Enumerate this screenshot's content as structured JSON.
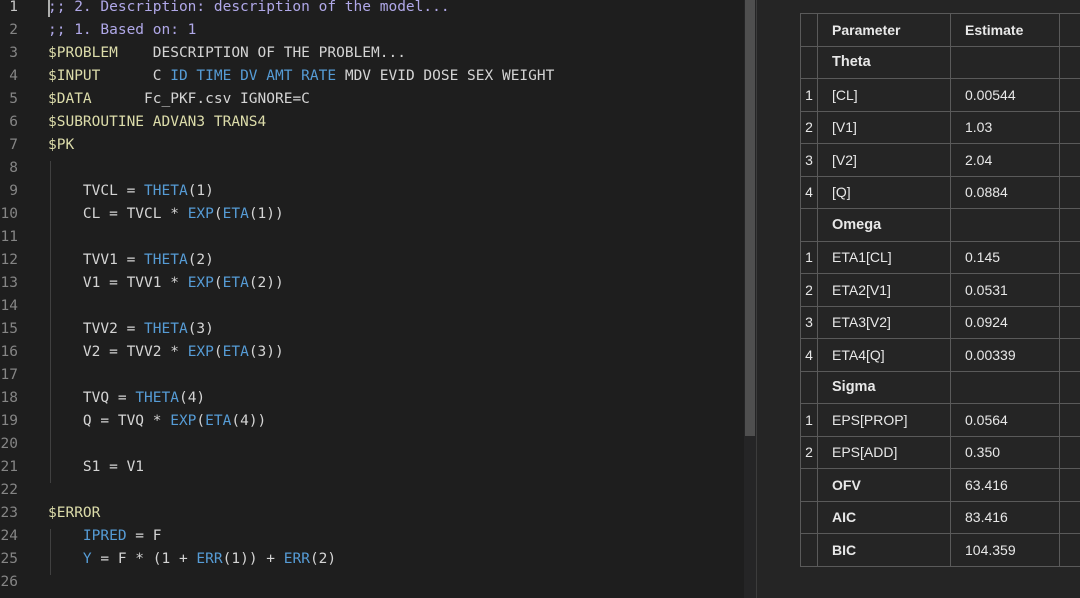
{
  "editor": {
    "lines": [
      {
        "n": "1",
        "tokens": [
          {
            "t": ";; 2. Description: description of the model...",
            "c": "cm2"
          }
        ]
      },
      {
        "n": "2",
        "tokens": [
          {
            "t": ";; 1. Based on: 1",
            "c": "cm2"
          }
        ]
      },
      {
        "n": "3",
        "tokens": [
          {
            "t": "$PROBLEM",
            "c": "kw"
          },
          {
            "t": "    DESCRIPTION OF THE PROBLEM...",
            "c": "pl"
          }
        ]
      },
      {
        "n": "4",
        "tokens": [
          {
            "t": "$INPUT",
            "c": "kw"
          },
          {
            "t": "      C ",
            "c": "pl"
          },
          {
            "t": "ID TIME DV AMT RATE",
            "c": "id"
          },
          {
            "t": " MDV EVID DOSE SEX WEIGHT",
            "c": "pl"
          }
        ]
      },
      {
        "n": "5",
        "tokens": [
          {
            "t": "$DATA",
            "c": "kw"
          },
          {
            "t": "      Fc_PKF.csv IGNORE=C",
            "c": "pl"
          }
        ]
      },
      {
        "n": "6",
        "tokens": [
          {
            "t": "$SUBROUTINE",
            "c": "kw"
          },
          {
            "t": " ADVAN3 TRANS4",
            "c": "kw"
          }
        ]
      },
      {
        "n": "7",
        "tokens": [
          {
            "t": "$PK",
            "c": "kw"
          }
        ]
      },
      {
        "n": "8",
        "tokens": []
      },
      {
        "n": "9",
        "tokens": [
          {
            "t": "    TVCL = ",
            "c": "pl"
          },
          {
            "t": "THETA",
            "c": "id"
          },
          {
            "t": "(1)",
            "c": "pl"
          }
        ]
      },
      {
        "n": "10",
        "tokens": [
          {
            "t": "    CL = TVCL * ",
            "c": "pl"
          },
          {
            "t": "EXP",
            "c": "id"
          },
          {
            "t": "(",
            "c": "pl"
          },
          {
            "t": "ETA",
            "c": "id"
          },
          {
            "t": "(1))",
            "c": "pl"
          }
        ]
      },
      {
        "n": "11",
        "tokens": []
      },
      {
        "n": "12",
        "tokens": [
          {
            "t": "    TVV1 = ",
            "c": "pl"
          },
          {
            "t": "THETA",
            "c": "id"
          },
          {
            "t": "(2)",
            "c": "pl"
          }
        ]
      },
      {
        "n": "13",
        "tokens": [
          {
            "t": "    V1 = TVV1 * ",
            "c": "pl"
          },
          {
            "t": "EXP",
            "c": "id"
          },
          {
            "t": "(",
            "c": "pl"
          },
          {
            "t": "ETA",
            "c": "id"
          },
          {
            "t": "(2))",
            "c": "pl"
          }
        ]
      },
      {
        "n": "14",
        "tokens": []
      },
      {
        "n": "15",
        "tokens": [
          {
            "t": "    TVV2 = ",
            "c": "pl"
          },
          {
            "t": "THETA",
            "c": "id"
          },
          {
            "t": "(3)",
            "c": "pl"
          }
        ]
      },
      {
        "n": "16",
        "tokens": [
          {
            "t": "    V2 = TVV2 * ",
            "c": "pl"
          },
          {
            "t": "EXP",
            "c": "id"
          },
          {
            "t": "(",
            "c": "pl"
          },
          {
            "t": "ETA",
            "c": "id"
          },
          {
            "t": "(3))",
            "c": "pl"
          }
        ]
      },
      {
        "n": "17",
        "tokens": []
      },
      {
        "n": "18",
        "tokens": [
          {
            "t": "    TVQ = ",
            "c": "pl"
          },
          {
            "t": "THETA",
            "c": "id"
          },
          {
            "t": "(4)",
            "c": "pl"
          }
        ]
      },
      {
        "n": "19",
        "tokens": [
          {
            "t": "    Q = TVQ * ",
            "c": "pl"
          },
          {
            "t": "EXP",
            "c": "id"
          },
          {
            "t": "(",
            "c": "pl"
          },
          {
            "t": "ETA",
            "c": "id"
          },
          {
            "t": "(4))",
            "c": "pl"
          }
        ]
      },
      {
        "n": "20",
        "tokens": []
      },
      {
        "n": "21",
        "tokens": [
          {
            "t": "    S1 = V1",
            "c": "pl"
          }
        ]
      },
      {
        "n": "22",
        "tokens": []
      },
      {
        "n": "23",
        "tokens": [
          {
            "t": "$ERROR",
            "c": "kw"
          }
        ]
      },
      {
        "n": "24",
        "tokens": [
          {
            "t": "    ",
            "c": "pl"
          },
          {
            "t": "IPRED",
            "c": "id"
          },
          {
            "t": " = F",
            "c": "pl"
          }
        ]
      },
      {
        "n": "25",
        "tokens": [
          {
            "t": "    ",
            "c": "pl"
          },
          {
            "t": "Y",
            "c": "id"
          },
          {
            "t": " = F * (1 + ",
            "c": "pl"
          },
          {
            "t": "ERR",
            "c": "id"
          },
          {
            "t": "(1)) + ",
            "c": "pl"
          },
          {
            "t": "ERR",
            "c": "id"
          },
          {
            "t": "(2)",
            "c": "pl"
          }
        ]
      },
      {
        "n": "26",
        "tokens": []
      }
    ]
  },
  "results": {
    "headers": {
      "parameter": "Parameter",
      "estimate": "Estimate"
    },
    "sections": [
      {
        "title": "Theta",
        "rows": [
          {
            "idx": "1",
            "name": "[CL]",
            "value": "0.00544"
          },
          {
            "idx": "2",
            "name": "[V1]",
            "value": "1.03"
          },
          {
            "idx": "3",
            "name": "[V2]",
            "value": "2.04"
          },
          {
            "idx": "4",
            "name": "[Q]",
            "value": "0.0884"
          }
        ]
      },
      {
        "title": "Omega",
        "rows": [
          {
            "idx": "1",
            "name": "ETA1[CL]",
            "value": "0.145"
          },
          {
            "idx": "2",
            "name": "ETA2[V1]",
            "value": "0.0531"
          },
          {
            "idx": "3",
            "name": "ETA3[V2]",
            "value": "0.0924"
          },
          {
            "idx": "4",
            "name": "ETA4[Q]",
            "value": "0.00339"
          }
        ]
      },
      {
        "title": "Sigma",
        "rows": [
          {
            "idx": "1",
            "name": "EPS[PROP]",
            "value": "0.0564"
          },
          {
            "idx": "2",
            "name": "EPS[ADD]",
            "value": "0.350"
          }
        ]
      }
    ],
    "stats": [
      {
        "name": "OFV",
        "value": "63.416"
      },
      {
        "name": "AIC",
        "value": "83.416"
      },
      {
        "name": "BIC",
        "value": "104.359"
      }
    ]
  }
}
